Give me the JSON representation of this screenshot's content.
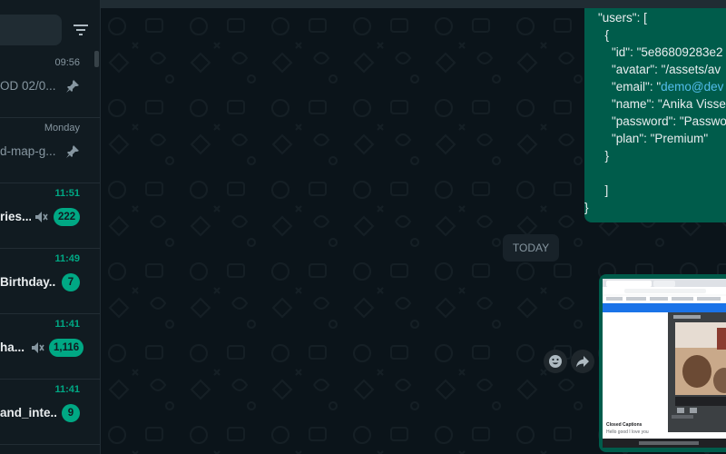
{
  "sidebar": {
    "chats": [
      {
        "time": "09:56",
        "preview": "OD 02/0...",
        "pinned": true,
        "muted": false,
        "unread": null
      },
      {
        "time": "Monday",
        "preview": "d-map-g...",
        "pinned": true,
        "muted": false,
        "unread": null
      },
      {
        "time": "11:51",
        "preview": "ries...",
        "pinned": false,
        "muted": true,
        "unread": "222"
      },
      {
        "time": "11:49",
        "preview": "Birthday...",
        "pinned": false,
        "muted": false,
        "unread": "7"
      },
      {
        "time": "11:41",
        "preview": "ha...",
        "pinned": false,
        "muted": true,
        "unread": "1,116"
      },
      {
        "time": "11:41",
        "preview": "and_inte...",
        "pinned": false,
        "muted": false,
        "unread": "9"
      }
    ]
  },
  "conversation": {
    "code_message": {
      "lines": [
        "\"users\": [",
        "  {",
        "    \"id\": \"5e86809283e2",
        "    \"avatar\": \"/assets/av",
        "    \"email\": \"",
        "    \"name\": \"Anika Visse",
        "    \"password\": \"Passwo",
        "    \"plan\": \"Premium\"",
        "  }",
        "",
        "  ]",
        "}"
      ],
      "email_link": "demo@dev"
    },
    "date_divider": "TODAY",
    "image_message": {
      "caption_title": "Closed Captions",
      "caption_text": "Hello good I love you"
    }
  },
  "colors": {
    "app_background": "#0b141a",
    "sidebar_background": "#111b21",
    "outgoing_bubble": "#005c4b",
    "accent_green": "#00a884",
    "link_blue": "#53bdeb"
  },
  "icons": {
    "filter": "filter-icon",
    "pin": "pin-icon",
    "mute": "mute-icon",
    "emoji": "emoji-icon",
    "forward": "forward-icon"
  }
}
